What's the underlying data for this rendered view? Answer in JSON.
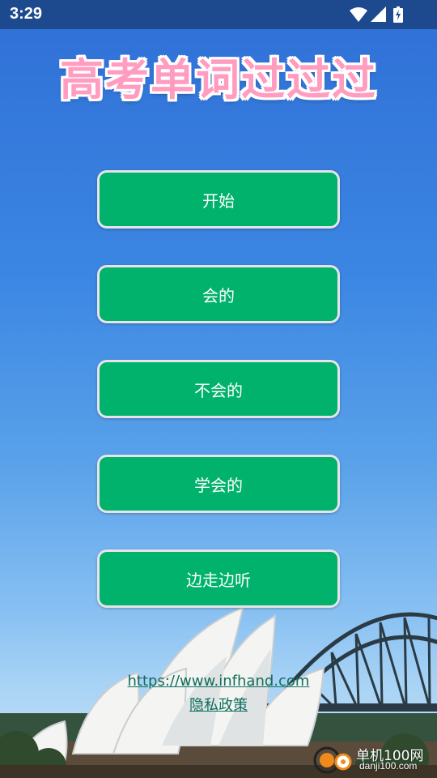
{
  "status_bar": {
    "time": "3:29",
    "icons": [
      "wifi-icon",
      "cellular-signal-icon",
      "battery-charging-icon"
    ]
  },
  "app": {
    "title": "高考单词过过过"
  },
  "menu": {
    "buttons": [
      {
        "label": "开始"
      },
      {
        "label": "会的"
      },
      {
        "label": "不会的"
      },
      {
        "label": "学会的"
      },
      {
        "label": "边走边听"
      }
    ]
  },
  "footer": {
    "website_link": "https://www.infhand.com",
    "privacy_link": "隐私政策"
  },
  "watermark": {
    "text": "单机100网",
    "subtext": "danji100.com"
  },
  "colors": {
    "button_green": "#00b26b",
    "title_pink": "#ff9cc0",
    "status_bar": "#1d4a8e",
    "link_teal": "#0f6e5e"
  }
}
